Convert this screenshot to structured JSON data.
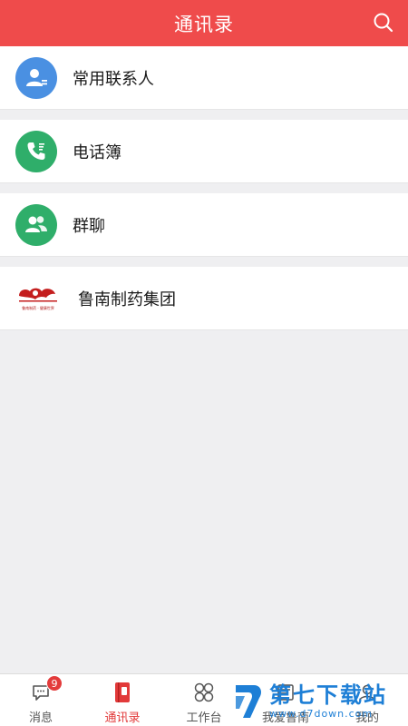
{
  "header": {
    "title": "通讯录",
    "search_icon": "search-icon"
  },
  "contacts": {
    "items": [
      {
        "label": "常用联系人",
        "icon": "user-card-icon",
        "color": "#4a90e2"
      },
      {
        "label": "电话簿",
        "icon": "phone-icon",
        "color": "#2fae6a"
      },
      {
        "label": "群聊",
        "icon": "group-icon",
        "color": "#2fae6a"
      }
    ],
    "organization": {
      "label": "鲁南制药集团",
      "logo_text": "鲁南制药 · 健康世界"
    }
  },
  "tabbar": {
    "tabs": [
      {
        "label": "消息",
        "icon": "message-icon",
        "badge": "9"
      },
      {
        "label": "通讯录",
        "icon": "contacts-book-icon",
        "active": true
      },
      {
        "label": "工作台",
        "icon": "workbench-icon"
      },
      {
        "label": "我爱鲁南",
        "icon": "news-icon"
      },
      {
        "label": "我的",
        "icon": "profile-icon"
      }
    ],
    "active_color": "#e23a3a"
  },
  "watermark": {
    "title": "第七下载站",
    "url": "www.d7down.com"
  }
}
